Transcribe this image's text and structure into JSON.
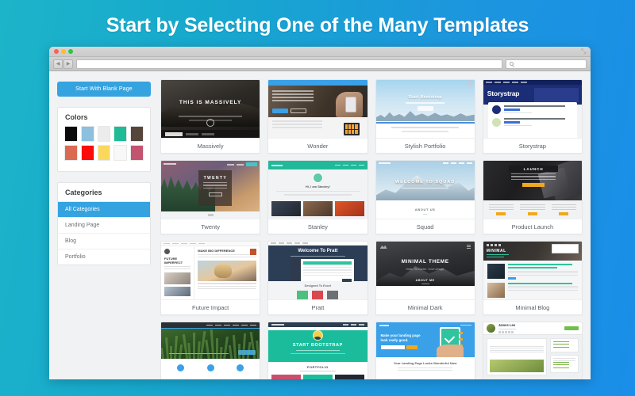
{
  "headline": "Start by Selecting One of the Many Templates",
  "browser": {
    "url_placeholder": "",
    "search_placeholder": "",
    "back_label": "◀",
    "forward_label": "▶",
    "traffic_lights": [
      "close",
      "minimize",
      "zoom"
    ],
    "resize_label": "⤡"
  },
  "sidebar": {
    "blank_page_button": "Start With Blank Page",
    "colors_title": "Colors",
    "color_rows": [
      [
        "#0a0a0a",
        "#8cc0dd",
        "#ececec",
        "#1fba96",
        "#55453a"
      ],
      [
        "#da6a52",
        "#fb0b09",
        "#fbd85c",
        "#f8f8f8",
        "#c2546f"
      ]
    ],
    "categories_title": "Categories",
    "categories": [
      {
        "label": "All Categories",
        "active": true
      },
      {
        "label": "Landing Page",
        "active": false
      },
      {
        "label": "Blog",
        "active": false
      },
      {
        "label": "Portfolio",
        "active": false
      }
    ]
  },
  "templates": [
    {
      "name": "Massively",
      "hero_title": "THIS IS MASSIVELY"
    },
    {
      "name": "Wonder",
      "hero_title": ""
    },
    {
      "name": "Stylish Portfolio",
      "hero_title": "Start Bootstrap"
    },
    {
      "name": "Storystrap",
      "hero_title": "Storystrap"
    },
    {
      "name": "Twenty",
      "hero_title": "TWENTY"
    },
    {
      "name": "Stanley",
      "hero_title": "Hi, I am Stanley!"
    },
    {
      "name": "Squad",
      "hero_title": "WELCOME TO SQUAD",
      "section": "ABOUT US"
    },
    {
      "name": "Product Launch",
      "hero_title": "LAUNCH"
    },
    {
      "name": "Future Impact",
      "hero_title": "FUTURE IMPERFECT",
      "section": "MAKE BIG DIFFERENCE"
    },
    {
      "name": "Pratt",
      "hero_title": "Welcome To Pratt",
      "section": "Designed To Excel"
    },
    {
      "name": "Minimal Dark",
      "hero_title": "MINIMAL THEME",
      "subtitle": "Hello, I'm Carter. I love design.",
      "section": "ABOUT ME"
    },
    {
      "name": "Minimal Blog",
      "hero_title": "MINIMAL"
    },
    {
      "name": "",
      "hero_title": ""
    },
    {
      "name": "",
      "hero_title": "START BOOTSTRAP",
      "section": "PORTFOLIO"
    },
    {
      "name": "",
      "hero_title": "Make your landing page look really good.",
      "section": "Your Landing Page Looks Wonderful Now"
    },
    {
      "name": "",
      "hero_title": "James Lee"
    }
  ],
  "accent": {
    "primary_blue": "#35a3e0",
    "background_gradient_start": "#1cb4c9",
    "background_gradient_end": "#1a8ee8"
  }
}
